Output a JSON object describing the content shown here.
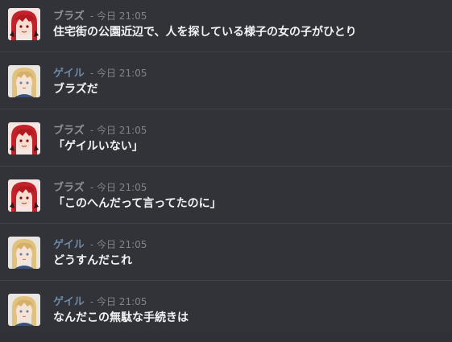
{
  "colors": {
    "background": "#313338",
    "divider": "#3f4147",
    "message_text": "#f2f3f5",
    "timestamp": "#80848e",
    "author_blaz": "#8e9297",
    "author_gale": "#6c8aa8"
  },
  "messages": [
    {
      "author": "ブラズ",
      "timestamp": "- 今日 21:05",
      "text": "住宅街の公園近辺で、人を探している様子の女の子がひとり",
      "avatar_icon": "red-hair-character-avatar",
      "author_color": "#8e9297"
    },
    {
      "author": "ゲイル",
      "timestamp": "- 今日 21:05",
      "text": "ブラズだ",
      "avatar_icon": "blonde-hair-character-avatar",
      "author_color": "#6c8aa8"
    },
    {
      "author": "ブラズ",
      "timestamp": "- 今日 21:05",
      "text": "「ゲイルいない」",
      "avatar_icon": "red-hair-character-avatar",
      "author_color": "#8e9297"
    },
    {
      "author": "ブラズ",
      "timestamp": "- 今日 21:05",
      "text": "「このへんだって言ってたのに」",
      "avatar_icon": "red-hair-character-avatar",
      "author_color": "#8e9297"
    },
    {
      "author": "ゲイル",
      "timestamp": "- 今日 21:05",
      "text": "どうすんだこれ",
      "avatar_icon": "blonde-hair-character-avatar",
      "author_color": "#6c8aa8"
    },
    {
      "author": "ゲイル",
      "timestamp": "- 今日 21:05",
      "text": "なんだこの無駄な手続きは",
      "avatar_icon": "blonde-hair-character-avatar",
      "author_color": "#6c8aa8"
    }
  ]
}
